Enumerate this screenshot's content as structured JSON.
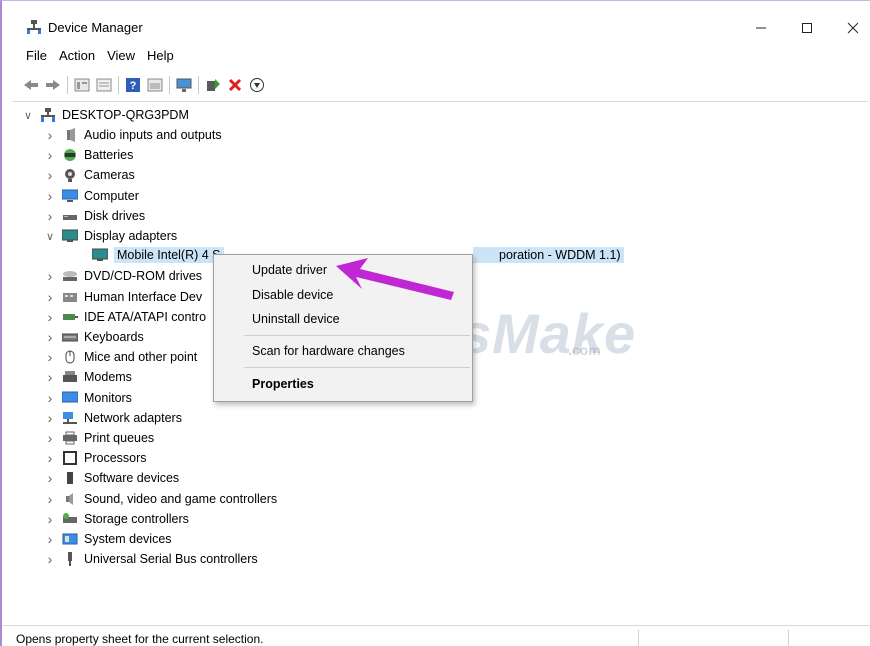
{
  "window": {
    "title": "Device Manager"
  },
  "menu": [
    "File",
    "Action",
    "View",
    "Help"
  ],
  "toolbar": {
    "icons": [
      "back-arrow-icon",
      "forward-arrow-icon",
      "properties-icon",
      "show-hidden-icon",
      "help-icon",
      "view-icon",
      "monitor-icon",
      "update-driver-icon",
      "uninstall-icon",
      "download-icon"
    ]
  },
  "tree": {
    "root": "DESKTOP-QRG3PDM",
    "categories": [
      {
        "label": "Audio inputs and outputs",
        "icon": "speaker-icon"
      },
      {
        "label": "Batteries",
        "icon": "battery-icon"
      },
      {
        "label": "Cameras",
        "icon": "camera-icon"
      },
      {
        "label": "Computer",
        "icon": "computer-icon"
      },
      {
        "label": "Disk drives",
        "icon": "disk-icon"
      },
      {
        "label": "Display adapters",
        "icon": "display-icon"
      },
      {
        "label": "DVD/CD-ROM drives",
        "icon": "dvd-icon"
      },
      {
        "label": "Human Interface Dev",
        "icon": "hid-icon"
      },
      {
        "label": "IDE ATA/ATAPI contro",
        "icon": "ide-icon"
      },
      {
        "label": "Keyboards",
        "icon": "keyboard-icon"
      },
      {
        "label": "Mice and other point",
        "icon": "mouse-icon"
      },
      {
        "label": "Modems",
        "icon": "modem-icon"
      },
      {
        "label": "Monitors",
        "icon": "monitor-icon"
      },
      {
        "label": "Network adapters",
        "icon": "network-icon"
      },
      {
        "label": "Print queues",
        "icon": "printer-icon"
      },
      {
        "label": "Processors",
        "icon": "processor-icon"
      },
      {
        "label": "Software devices",
        "icon": "software-icon"
      },
      {
        "label": "Sound, video and game controllers",
        "icon": "sound-icon"
      },
      {
        "label": "Storage controllers",
        "icon": "storage-icon"
      },
      {
        "label": "System devices",
        "icon": "system-icon"
      },
      {
        "label": "Universal Serial Bus controllers",
        "icon": "usb-icon"
      }
    ],
    "display_child": {
      "label_visible_left": "Mobile Intel(R) 4 S",
      "label_visible_right": "poration - WDDM 1.1)"
    }
  },
  "context_menu": {
    "items": [
      "Update driver",
      "Disable device",
      "Uninstall device",
      "Scan for hardware changes",
      "Properties"
    ]
  },
  "watermark": {
    "main": "TipsMake",
    "suffix": ".com"
  },
  "status": {
    "text": "Opens property sheet for the current selection."
  },
  "colors": {
    "selection": "#cce4f7",
    "arrow": "#c026d3",
    "border": "#a98ad0"
  }
}
